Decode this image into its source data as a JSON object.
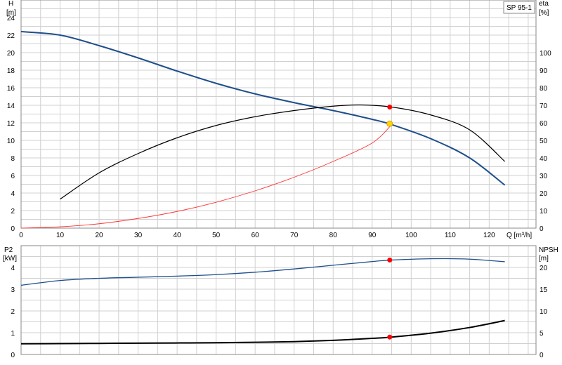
{
  "chart_data": [
    {
      "type": "line",
      "title": "",
      "pump_label": "SP 95-1",
      "xlabel": "Q [m³/h]",
      "ylabel_left_name": "H",
      "ylabel_left_unit": "[m]",
      "ylabel_right_name": "eta",
      "ylabel_right_unit": "[%]",
      "xlim": [
        0,
        132
      ],
      "ylim_left": [
        0,
        26
      ],
      "ylim_right": [
        0,
        130
      ],
      "x_ticks": [
        "0",
        "10",
        "20",
        "30",
        "40",
        "50",
        "60",
        "70",
        "80",
        "90",
        "100",
        "110",
        "120"
      ],
      "y_left_ticks": [
        "0",
        "2",
        "4",
        "6",
        "8",
        "10",
        "12",
        "14",
        "16",
        "18",
        "20",
        "22",
        "24"
      ],
      "y_right_ticks": [
        "0",
        "10",
        "20",
        "30",
        "40",
        "50",
        "60",
        "70",
        "80",
        "90",
        "100"
      ],
      "grid": true,
      "series": [
        {
          "axis": "left",
          "color": "#1f4e8c",
          "x": [
            0,
            10,
            20,
            30,
            40,
            50,
            60,
            70,
            80,
            90,
            95,
            105,
            115,
            124
          ],
          "y": [
            22.4,
            22.0,
            20.8,
            19.4,
            17.9,
            16.5,
            15.3,
            14.3,
            13.4,
            12.4,
            11.8,
            10.2,
            8.0,
            4.9
          ]
        },
        {
          "axis": "right",
          "color": "#000000",
          "x": [
            10,
            20,
            30,
            40,
            50,
            60,
            70,
            80,
            87,
            95,
            105,
            115,
            124
          ],
          "y": [
            16.5,
            31.5,
            42.5,
            51.5,
            58.5,
            63.5,
            67,
            69.5,
            70.2,
            69,
            64.5,
            56,
            38
          ]
        },
        {
          "axis": "left",
          "color": "#ff3333",
          "x": [
            0,
            10,
            20,
            30,
            40,
            50,
            60,
            70,
            80,
            90,
            95
          ],
          "y": [
            0,
            0.15,
            0.5,
            1.1,
            1.9,
            2.95,
            4.25,
            5.8,
            7.6,
            9.7,
            11.8
          ]
        }
      ],
      "markers": [
        {
          "axis": "right",
          "x": 94.5,
          "y": 69,
          "color": "#ff0000"
        },
        {
          "axis": "left",
          "x": 94.5,
          "y": 11.9,
          "color": "#ffd700"
        }
      ]
    },
    {
      "type": "line",
      "title": "",
      "xlim": [
        0,
        132
      ],
      "ylabel_left_name": "P2",
      "ylabel_left_unit": "[kW]",
      "ylabel_right_name": "NPSH",
      "ylabel_right_unit": "[m]",
      "ylim_left": [
        0,
        5
      ],
      "ylim_right": [
        0,
        25
      ],
      "y_left_ticks": [
        "0",
        "1",
        "2",
        "3",
        "4"
      ],
      "y_right_ticks": [
        "0",
        "5",
        "10",
        "15",
        "20"
      ],
      "grid": true,
      "series": [
        {
          "axis": "left",
          "color": "#1f4e8c",
          "x": [
            0,
            10,
            20,
            30,
            40,
            50,
            60,
            70,
            80,
            90,
            95,
            105,
            115,
            124
          ],
          "y": [
            3.18,
            3.4,
            3.5,
            3.55,
            3.6,
            3.67,
            3.78,
            3.93,
            4.1,
            4.27,
            4.34,
            4.4,
            4.38,
            4.26
          ]
        },
        {
          "axis": "right",
          "color": "#000000",
          "x": [
            0,
            10,
            20,
            30,
            40,
            50,
            60,
            70,
            80,
            90,
            95,
            105,
            115,
            124
          ],
          "y": [
            2.45,
            2.5,
            2.55,
            2.6,
            2.65,
            2.7,
            2.8,
            2.95,
            3.25,
            3.7,
            4.0,
            4.9,
            6.2,
            7.8
          ]
        }
      ],
      "markers": [
        {
          "axis": "left",
          "x": 94.5,
          "y": 4.34,
          "color": "#ff0000"
        },
        {
          "axis": "right",
          "x": 94.5,
          "y": 4.0,
          "color": "#ff0000"
        }
      ]
    }
  ]
}
